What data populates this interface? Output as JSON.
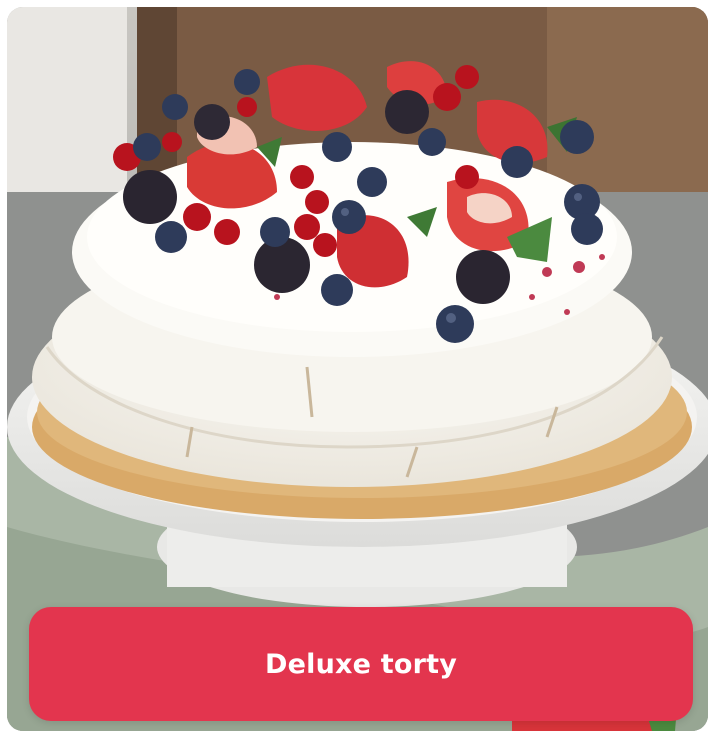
{
  "category_card": {
    "image_icon": "pavlova-cake-photo",
    "button_label": "Deluxe torty",
    "accent_color": "#e3354e"
  }
}
